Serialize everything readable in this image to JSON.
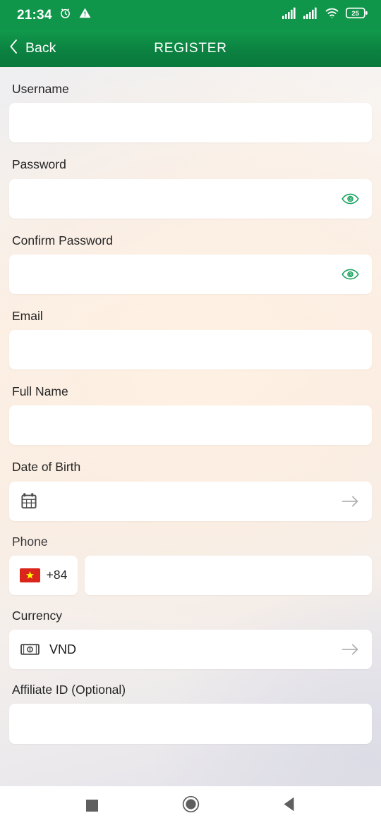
{
  "status_bar": {
    "time": "21:34",
    "left_icons": [
      "alarm-clock-icon",
      "warning-triangle-icon"
    ],
    "right_icons": [
      "signal-bars-sim1-icon",
      "signal-bars-sim2-icon",
      "wifi-icon",
      "battery-icon"
    ],
    "battery_level": "25",
    "background_color": "#10964a"
  },
  "header": {
    "back_label": "Back",
    "title": "REGISTER",
    "background_color": "#0b8040",
    "text_color": "#ffffff"
  },
  "form": {
    "accent_color": "#12a05a",
    "fields": [
      {
        "label": "Username",
        "value": "",
        "placeholder": ""
      },
      {
        "label": "Password",
        "value": "",
        "placeholder": ""
      },
      {
        "label": "Confirm Password",
        "value": "",
        "placeholder": ""
      },
      {
        "label": "Email",
        "value": "",
        "placeholder": ""
      },
      {
        "label": "Full Name",
        "value": "",
        "placeholder": ""
      },
      {
        "label": "Date of Birth",
        "value": "",
        "placeholder": ""
      },
      {
        "label": "Phone",
        "value": "",
        "placeholder": ""
      },
      {
        "label": "Currency",
        "value": "VND",
        "placeholder": ""
      },
      {
        "label": "Affiliate ID (Optional)",
        "value": "",
        "placeholder": ""
      }
    ],
    "phone": {
      "country_flag": "vietnam-flag",
      "country_code": "+84",
      "flag_color": "#da251d",
      "star_color": "#ffff00",
      "number": ""
    },
    "currency": {
      "icon": "banknote-icon",
      "value": "VND"
    },
    "date_of_birth": {
      "icon": "calendar-icon",
      "value": ""
    }
  },
  "nav_bar": {
    "buttons": [
      "recents-square-icon",
      "home-circle-icon",
      "back-triangle-icon"
    ],
    "icon_color": "#5f5f5f",
    "background_color": "#ffffff"
  }
}
